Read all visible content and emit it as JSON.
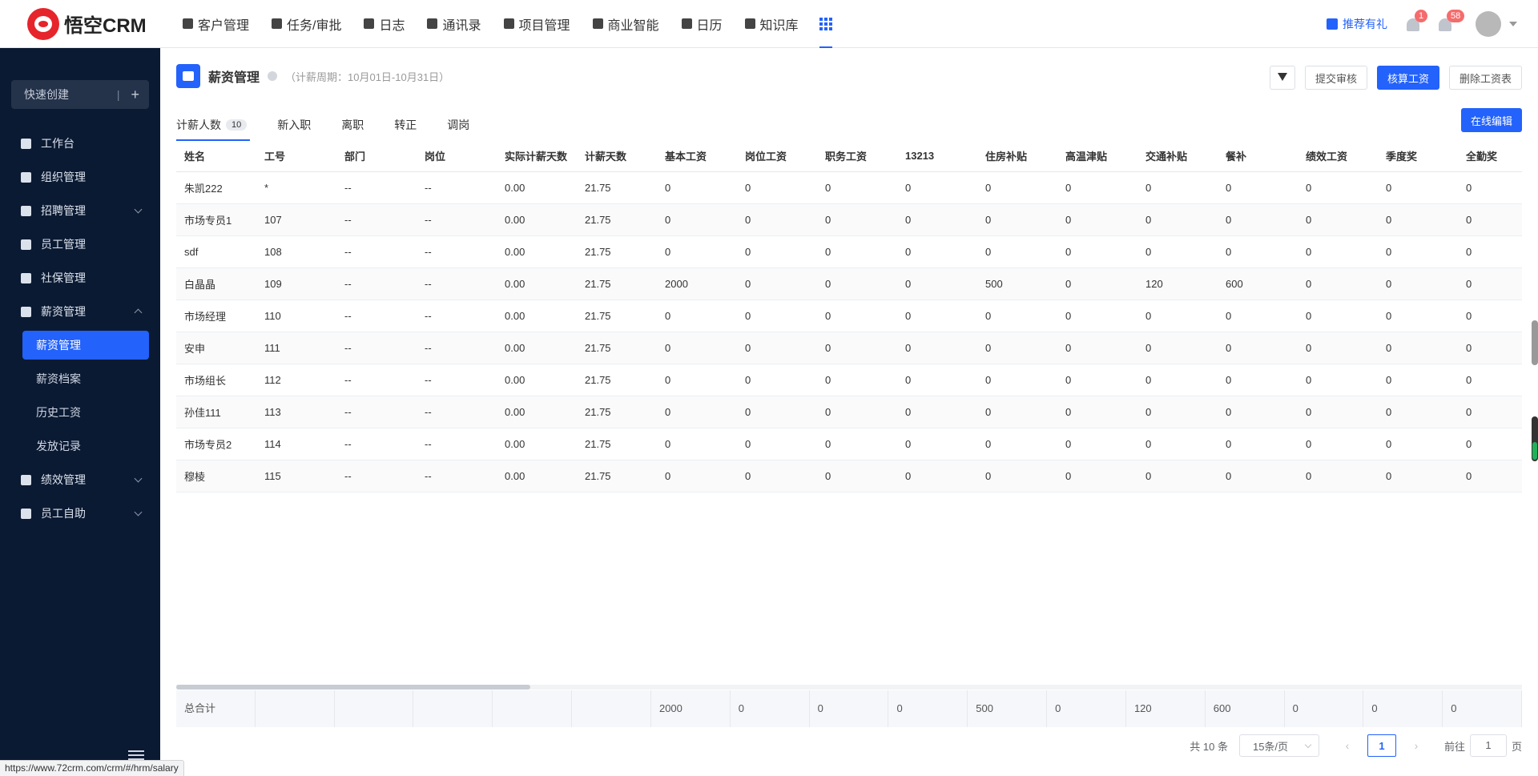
{
  "app": {
    "brand": "悟空CRM"
  },
  "nav": {
    "items": [
      "客户管理",
      "任务/审批",
      "日志",
      "通讯录",
      "项目管理",
      "商业智能",
      "日历",
      "知识库"
    ]
  },
  "topRight": {
    "recommend": "推荐有礼",
    "announceBadge": "1",
    "bellBadge": "58"
  },
  "sidebar": {
    "quickCreate": "快速创建",
    "items": [
      {
        "label": "工作台"
      },
      {
        "label": "组织管理"
      },
      {
        "label": "招聘管理"
      },
      {
        "label": "员工管理"
      },
      {
        "label": "社保管理"
      },
      {
        "label": "薪资管理"
      }
    ],
    "subItems": [
      "薪资管理",
      "薪资档案",
      "历史工资",
      "发放记录"
    ],
    "itemsAfter": [
      {
        "label": "绩效管理"
      },
      {
        "label": "员工自助"
      }
    ]
  },
  "page": {
    "title": "薪资管理",
    "period": "（计薪周期：10月01日-10月31日）",
    "actions": {
      "submit": "提交审核",
      "calculate": "核算工资",
      "delete": "删除工资表"
    },
    "editOnline": "在线编辑"
  },
  "tabs": [
    {
      "label": "计薪人数",
      "count": "10"
    },
    {
      "label": "新入职"
    },
    {
      "label": "离职"
    },
    {
      "label": "转正"
    },
    {
      "label": "调岗"
    }
  ],
  "table": {
    "columns": [
      "姓名",
      "工号",
      "部门",
      "岗位",
      "实际计薪天数",
      "计薪天数",
      "基本工资",
      "岗位工资",
      "职务工资",
      "13213",
      "住房补贴",
      "高温津贴",
      "交通补贴",
      "餐补",
      "绩效工资",
      "季度奖",
      "全勤奖"
    ],
    "rows": [
      [
        "朱凯222",
        "*",
        "--",
        "--",
        "0.00",
        "21.75",
        "0",
        "0",
        "0",
        "0",
        "0",
        "0",
        "0",
        "0",
        "0",
        "0",
        "0"
      ],
      [
        "市场专员1",
        "107",
        "--",
        "--",
        "0.00",
        "21.75",
        "0",
        "0",
        "0",
        "0",
        "0",
        "0",
        "0",
        "0",
        "0",
        "0",
        "0"
      ],
      [
        "sdf",
        "108",
        "--",
        "--",
        "0.00",
        "21.75",
        "0",
        "0",
        "0",
        "0",
        "0",
        "0",
        "0",
        "0",
        "0",
        "0",
        "0"
      ],
      [
        "白晶晶",
        "109",
        "--",
        "--",
        "0.00",
        "21.75",
        "2000",
        "0",
        "0",
        "0",
        "500",
        "0",
        "120",
        "600",
        "0",
        "0",
        "0"
      ],
      [
        "市场经理",
        "110",
        "--",
        "--",
        "0.00",
        "21.75",
        "0",
        "0",
        "0",
        "0",
        "0",
        "0",
        "0",
        "0",
        "0",
        "0",
        "0"
      ],
      [
        "安申",
        "111",
        "--",
        "--",
        "0.00",
        "21.75",
        "0",
        "0",
        "0",
        "0",
        "0",
        "0",
        "0",
        "0",
        "0",
        "0",
        "0"
      ],
      [
        "市场组长",
        "112",
        "--",
        "--",
        "0.00",
        "21.75",
        "0",
        "0",
        "0",
        "0",
        "0",
        "0",
        "0",
        "0",
        "0",
        "0",
        "0"
      ],
      [
        "孙佳111",
        "113",
        "--",
        "--",
        "0.00",
        "21.75",
        "0",
        "0",
        "0",
        "0",
        "0",
        "0",
        "0",
        "0",
        "0",
        "0",
        "0"
      ],
      [
        "市场专员2",
        "114",
        "--",
        "--",
        "0.00",
        "21.75",
        "0",
        "0",
        "0",
        "0",
        "0",
        "0",
        "0",
        "0",
        "0",
        "0",
        "0"
      ],
      [
        "穆棱",
        "115",
        "--",
        "--",
        "0.00",
        "21.75",
        "0",
        "0",
        "0",
        "0",
        "0",
        "0",
        "0",
        "0",
        "0",
        "0",
        "0"
      ]
    ],
    "totals": [
      "总合计",
      "",
      "",
      "",
      "",
      "",
      "2000",
      "0",
      "0",
      "0",
      "500",
      "0",
      "120",
      "600",
      "0",
      "0",
      "0"
    ]
  },
  "pager": {
    "total": "共 10 条",
    "pageSize": "15条/页",
    "current": "1",
    "gotoLabel": "前往",
    "gotoValue": "1",
    "pageUnit": "页"
  },
  "statusUrl": "https://www.72crm.com/crm/#/hrm/salary",
  "colors": {
    "primary": "#2362fb",
    "sidebar": "#0b1a33",
    "badge": "#f56c6c"
  }
}
